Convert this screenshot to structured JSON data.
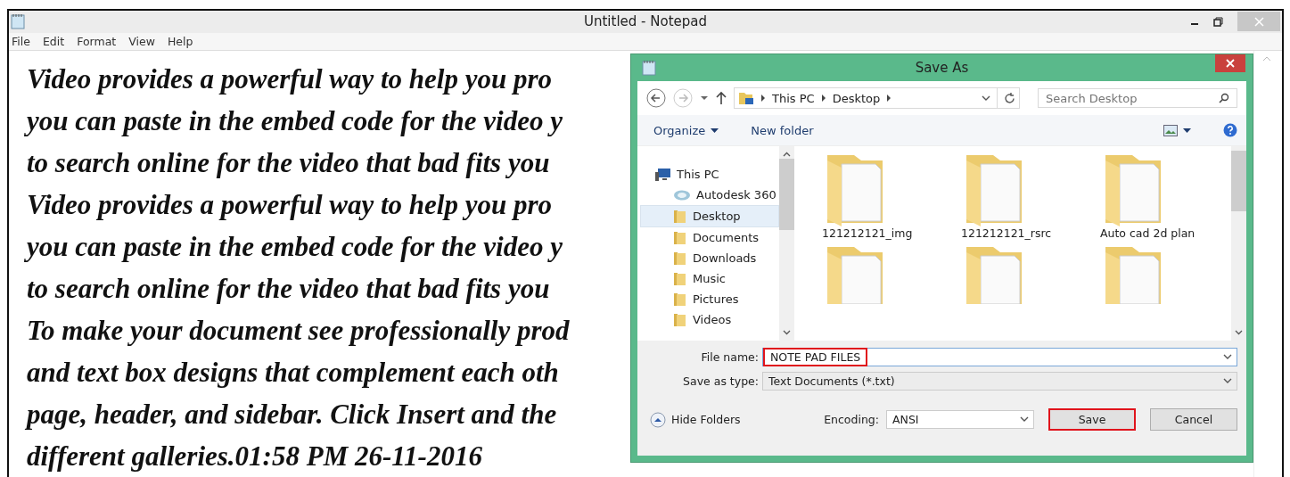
{
  "window": {
    "title": "Untitled - Notepad"
  },
  "menu": [
    "File",
    "Edit",
    "Format",
    "View",
    "Help"
  ],
  "document_lines": [
    "Video provides a powerful way to help you pro",
    "you can paste in the embed code for the video y",
    "to search online for the video that bad fits you",
    "Video provides a powerful way to help you pro",
    "you can paste in the embed code for the video y",
    "to search online for the video that bad fits you",
    "To make your document see professionally prod",
    "and text box designs that complement each oth",
    "page, header, and sidebar. Click Insert and the",
    "different galleries.01:58 PM 26-11-2016"
  ],
  "dialog": {
    "title": "Save As",
    "breadcrumb": [
      "This PC",
      "Desktop"
    ],
    "search": {
      "placeholder": "Search Desktop"
    },
    "toolbar": [
      "Organize",
      "New folder"
    ],
    "nav_tree": [
      {
        "label": "This PC",
        "selected": false,
        "children": [
          {
            "label": "Autodesk 360",
            "selected": false
          },
          {
            "label": "Desktop",
            "selected": true
          },
          {
            "label": "Documents",
            "selected": false
          },
          {
            "label": "Downloads",
            "selected": false
          },
          {
            "label": "Music",
            "selected": false
          },
          {
            "label": "Pictures",
            "selected": false
          },
          {
            "label": "Videos",
            "selected": false
          }
        ]
      }
    ],
    "files": [
      {
        "name": "121212121_img"
      },
      {
        "name": "121212121_rsrc"
      },
      {
        "name": "Auto cad 2d plan"
      }
    ],
    "file_name": {
      "label": "File name:",
      "value": "NOTE PAD FILES",
      "highlighted": true
    },
    "save_as_type": {
      "label": "Save as type:",
      "value": "Text Documents (*.txt)"
    },
    "hide_folders": "Hide Folders",
    "encoding": {
      "label": "Encoding:",
      "value": "ANSI"
    },
    "buttons": [
      {
        "label": "Save",
        "highlighted": true
      },
      {
        "label": "Cancel",
        "highlighted": false
      }
    ]
  }
}
